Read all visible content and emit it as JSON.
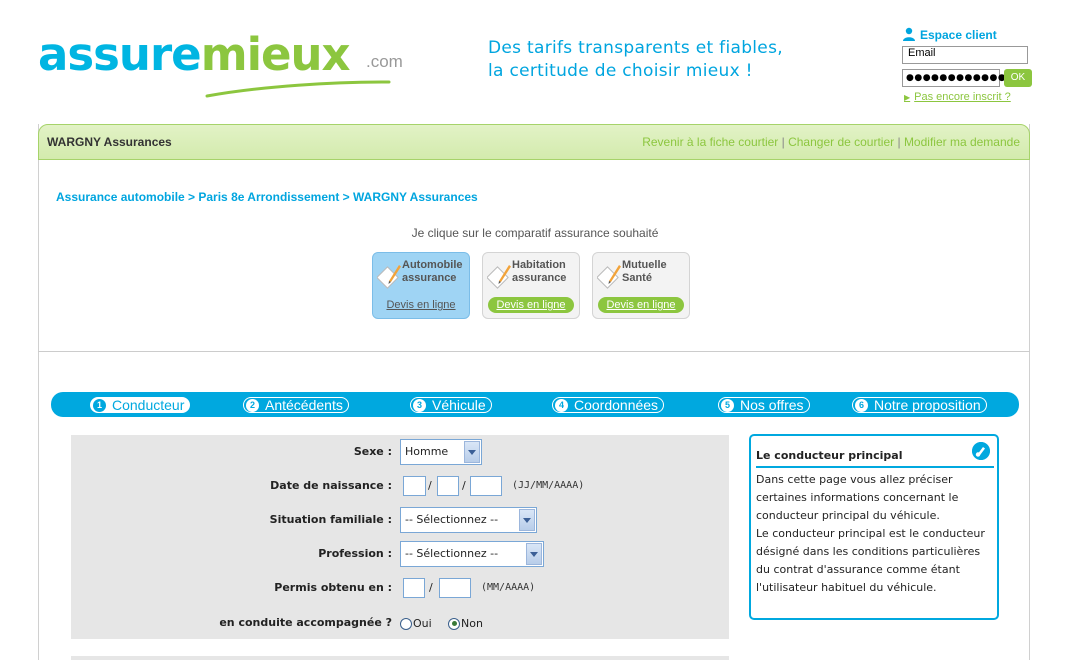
{
  "brand": {
    "logo_part1": "assure",
    "logo_part2": "mieux",
    "logo_suffix": ".com",
    "colors": {
      "blue": "#00b5e2",
      "green": "#8cc63f"
    }
  },
  "tagline": {
    "line1": "Des tarifs transparents et fiables,",
    "line2": "la certitude de choisir mieux !"
  },
  "client": {
    "title": "Espace client",
    "email_value": "Email",
    "password_mask": "●●●●●●●●●●●●",
    "ok_label": "OK",
    "register_link": "Pas encore inscrit ?",
    "icon": "user-icon"
  },
  "panel": {
    "title": "WARGNY Assurances",
    "links": [
      "Revenir à la fiche courtier",
      "Changer de courtier",
      "Modifier ma demande"
    ],
    "separator": " | "
  },
  "breadcrumb": "Assurance automobile > Paris 8e Arrondissement > WARGNY Assurances",
  "chooser": {
    "label": "Je clique sur le comparatif assurance souhaité",
    "products": [
      {
        "title_l1": "Automobile",
        "title_l2": "assurance",
        "link": "Devis en ligne",
        "active": true
      },
      {
        "title_l1": "Habitation",
        "title_l2": "assurance",
        "link": "Devis en ligne",
        "active": false
      },
      {
        "title_l1": "Mutuelle",
        "title_l2": "Santé",
        "link": "Devis en ligne",
        "active": false
      }
    ]
  },
  "steps": [
    {
      "num": "1",
      "label": "Conducteur",
      "active": true
    },
    {
      "num": "2",
      "label": "Antécédents",
      "active": false
    },
    {
      "num": "3",
      "label": "Véhicule",
      "active": false
    },
    {
      "num": "4",
      "label": "Coordonnées",
      "active": false
    },
    {
      "num": "5",
      "label": "Nos offres",
      "active": false
    },
    {
      "num": "6",
      "label": "Notre proposition",
      "active": false
    }
  ],
  "form": {
    "sexe": {
      "label": "Sexe :",
      "value": "Homme"
    },
    "naissance": {
      "label": "Date de naissance :",
      "sep": "/",
      "format": "(JJ/MM/AAAA)"
    },
    "situation": {
      "label": "Situation familiale :",
      "value": "-- Sélectionnez --"
    },
    "profession": {
      "label": "Profession :",
      "value": "-- Sélectionnez --"
    },
    "permis": {
      "label": "Permis obtenu en :",
      "sep": "/",
      "format": "(MM/AAAA)"
    },
    "conduite": {
      "label": "en conduite accompagnée ?",
      "opt_yes": "Oui",
      "opt_no": "Non",
      "selected": "Non"
    }
  },
  "info": {
    "title": "Le conducteur principal",
    "icon": "pencil-icon",
    "body": "Dans cette page vous allez préciser certaines informations concernant le conducteur principal du véhicule.\nLe conducteur principal est le conducteur désigné dans les conditions particulières du contrat d'assurance comme étant l'utilisateur habituel du véhicule."
  }
}
